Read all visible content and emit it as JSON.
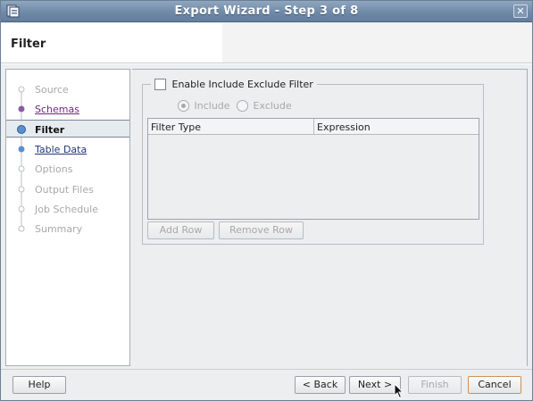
{
  "window": {
    "title": "Export Wizard - Step 3 of 8",
    "close_glyph": "✕"
  },
  "header": {
    "title": "Filter"
  },
  "nav": {
    "items": [
      {
        "label": "Source",
        "state": "disabled"
      },
      {
        "label": "Schemas",
        "state": "visited"
      },
      {
        "label": "Filter",
        "state": "active"
      },
      {
        "label": "Table Data",
        "state": "link"
      },
      {
        "label": "Options",
        "state": "disabled"
      },
      {
        "label": "Output Files",
        "state": "disabled"
      },
      {
        "label": "Job Schedule",
        "state": "disabled"
      },
      {
        "label": "Summary",
        "state": "disabled"
      }
    ]
  },
  "filter": {
    "enable_label": "Enable Include Exclude Filter",
    "enable_checked": false,
    "include_label": "Include",
    "exclude_label": "Exclude",
    "include_selected": true,
    "table": {
      "columns": [
        "Filter Type",
        "Expression"
      ],
      "rows": []
    },
    "add_row_label": "Add Row",
    "remove_row_label": "Remove Row"
  },
  "footer": {
    "help_label": "Help",
    "back_label": "< Back",
    "next_label": "Next >",
    "finish_label": "Finish",
    "cancel_label": "Cancel"
  },
  "colors": {
    "title_bar": "#6f8aa8",
    "link": "#23357a",
    "visited_link": "#6e2a7e",
    "disabled_text": "#a8a8a8",
    "nav_step_active": "#5a8fd0",
    "nav_step_visited": "#8e5aa8"
  }
}
